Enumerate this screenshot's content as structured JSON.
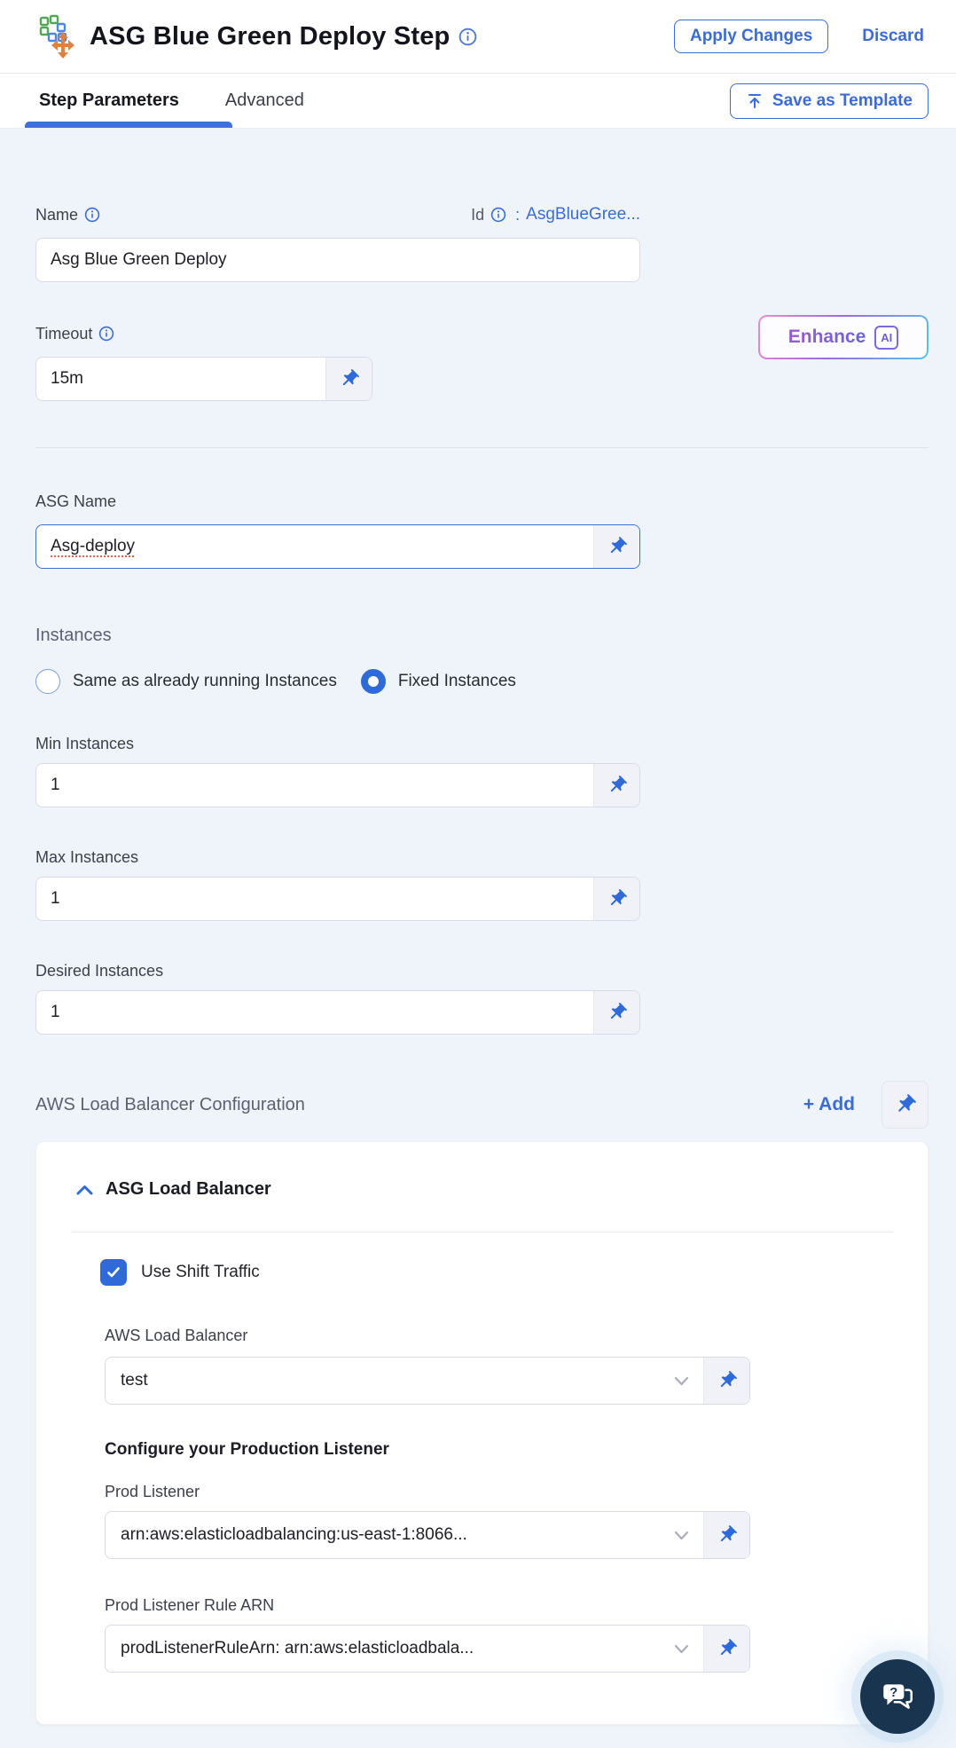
{
  "window": {
    "title": "ASG Blue Green Deploy Step"
  },
  "header": {
    "apply_button": "Apply Changes",
    "discard_button": "Discard"
  },
  "tabs": {
    "step_parameters": "Step Parameters",
    "advanced": "Advanced",
    "save_as_template": "Save as Template"
  },
  "enhance": {
    "label": "Enhance",
    "badge": "AI"
  },
  "form": {
    "name": {
      "label": "Name",
      "value": "Asg Blue Green Deploy"
    },
    "id": {
      "label": "Id",
      "colon": ":",
      "value": "AsgBlueGree..."
    },
    "timeout": {
      "label": "Timeout",
      "value": "15m"
    },
    "asg_name": {
      "label": "ASG Name",
      "value": "Asg-deploy"
    },
    "instances": {
      "heading": "Instances",
      "options": [
        {
          "label": "Same as already running Instances",
          "selected": false
        },
        {
          "label": "Fixed Instances",
          "selected": true
        }
      ],
      "min": {
        "label": "Min Instances",
        "value": "1"
      },
      "max": {
        "label": "Max Instances",
        "value": "1"
      },
      "desired": {
        "label": "Desired Instances",
        "value": "1"
      }
    }
  },
  "load_balancer": {
    "heading": "AWS Load Balancer Configuration",
    "add_button": "+ Add",
    "panel": {
      "title": "ASG Load Balancer",
      "use_shift_traffic_label": "Use Shift Traffic",
      "use_shift_traffic_checked": true,
      "aws_load_balancer": {
        "label": "AWS Load Balancer",
        "value": "test"
      },
      "production_listener_heading": "Configure your Production Listener",
      "prod_listener": {
        "label": "Prod Listener",
        "value": "arn:aws:elasticloadbalancing:us-east-1:8066..."
      },
      "prod_listener_rule_arn": {
        "label": "Prod Listener Rule ARN",
        "value": "prodListenerRuleArn: arn:aws:elasticloadbala..."
      }
    }
  },
  "icons": {
    "step": "asg-step-icon",
    "info": "ⓘ",
    "upload": "↥",
    "pin": "📌",
    "chevron_up": "⌃",
    "chevron_down": "⌄",
    "checkbox_check": "✓",
    "help_chat": "?"
  },
  "colors": {
    "primary_blue": "#3b6bd6",
    "selected_control_blue": "#2f6bd8",
    "content_background": "#eff4fb",
    "enhance_gradient": [
      "#f08ccc",
      "#9a6be2",
      "#5ac4ea"
    ],
    "help_button_navy": "#18344f",
    "spellcheck_underline": "#e2604b"
  }
}
